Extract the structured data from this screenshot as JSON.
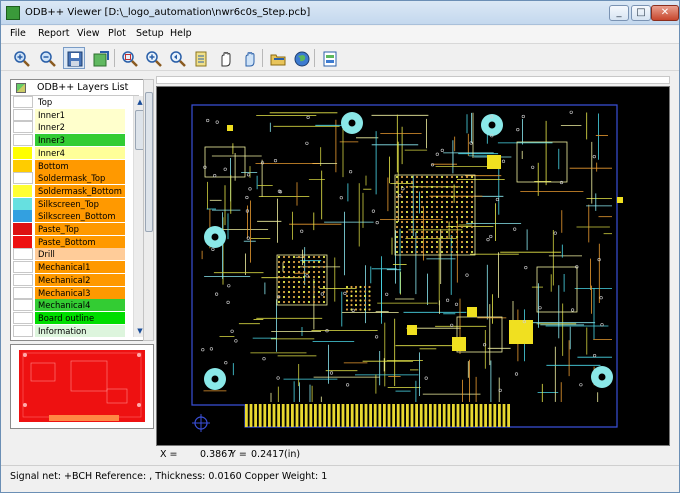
{
  "window": {
    "title": "ODB++ Viewer [D:\\_logo_automation\\nwr6c0s_Step.pcb]",
    "minimize": "_",
    "maximize": "□",
    "close": "✕"
  },
  "menu": [
    "File",
    "Report",
    "View",
    "Plot",
    "Setup",
    "Help"
  ],
  "toolbar": {
    "icons": [
      "zoom-in-icon",
      "zoom-out-icon",
      "save-icon",
      "export-icon",
      "zoom-window-icon",
      "zoom-fit-icon",
      "zoom-previous-icon",
      "layer-icon",
      "pan-icon",
      "pan-hand-icon",
      "open-folder-icon",
      "globe-icon",
      "report-icon"
    ]
  },
  "layers_panel": {
    "header": "ODB++ Layers List",
    "scroll_up": "▲",
    "scroll_down": "▼",
    "layers": [
      {
        "name": "Top",
        "swatch": "#ffffff",
        "row": "#ffffff"
      },
      {
        "name": "Inner1",
        "swatch": "#ffffff",
        "row": "#ffffcc"
      },
      {
        "name": "Inner2",
        "swatch": "#ffffff",
        "row": "#ffffcc"
      },
      {
        "name": "Inner3",
        "swatch": "#ffffff",
        "row": "#33cc33"
      },
      {
        "name": "Inner4",
        "swatch": "#ffff00",
        "row": "#ffff99"
      },
      {
        "name": "Bottom",
        "swatch": "#ffcc00",
        "row": "#ff9900"
      },
      {
        "name": "Soldermask_Top",
        "swatch": "#ffffff",
        "row": "#ff9900"
      },
      {
        "name": "Soldermask_Bottom",
        "swatch": "#ffff33",
        "row": "#ff9900"
      },
      {
        "name": "Silkscreen_Top",
        "swatch": "#66e0e0",
        "row": "#ff9900"
      },
      {
        "name": "Silkscreen_Bottom",
        "swatch": "#33a0e0",
        "row": "#ff9900"
      },
      {
        "name": "Paste_Top",
        "swatch": "#dd1111",
        "row": "#ff9900"
      },
      {
        "name": "Paste_Bottom",
        "swatch": "#ee1111",
        "row": "#ff9900"
      },
      {
        "name": "Drill",
        "swatch": "#ffffff",
        "row": "#ffcc99"
      },
      {
        "name": "Mechanical1",
        "swatch": "#ffffff",
        "row": "#ff9900"
      },
      {
        "name": "Mechanical2",
        "swatch": "#ffffff",
        "row": "#ff9900"
      },
      {
        "name": "Mechanical3",
        "swatch": "#ffffff",
        "row": "#ff9900"
      },
      {
        "name": "Mechanical4",
        "swatch": "#ffffff",
        "row": "#33cc33"
      },
      {
        "name": "Board outline",
        "swatch": "#ffffff",
        "row": "#00dd00"
      },
      {
        "name": "Information",
        "swatch": "#ffffff",
        "row": "#ddf5dd"
      }
    ]
  },
  "coordinates": {
    "x_label": "X =",
    "x_value": "0.3867",
    "y_label": "Y =",
    "y_value": "0.2417",
    "unit": "(in)"
  },
  "status": "Signal net: +BCH Reference: , Thickness: 0.0160 Copper Weight: 1"
}
